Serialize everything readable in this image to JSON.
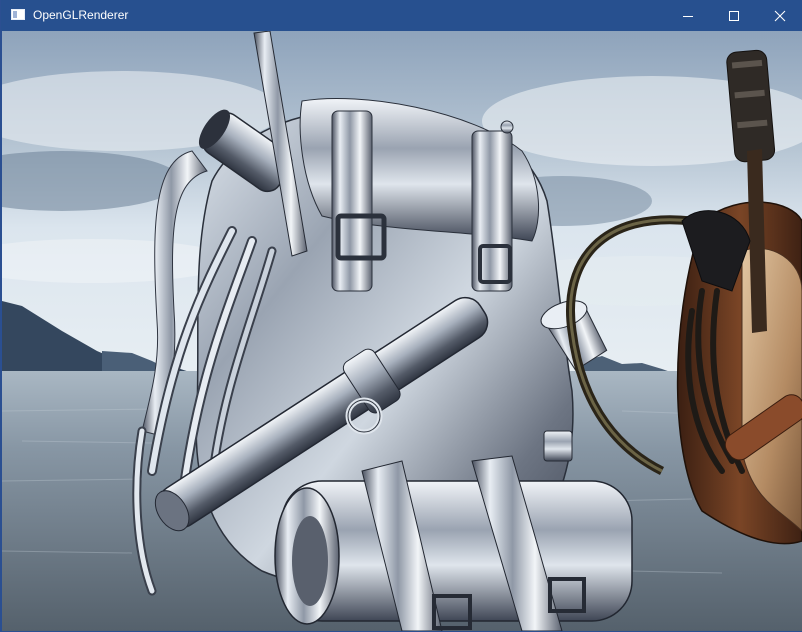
{
  "window": {
    "title": "OpenGLRenderer",
    "icon": "app-window-icon",
    "controls": [
      {
        "name": "minimize",
        "icon": "minimize-icon"
      },
      {
        "name": "maximize",
        "icon": "maximize-icon"
      },
      {
        "name": "close",
        "icon": "close-icon"
      }
    ]
  },
  "scene": {
    "description_colors": {
      "titlebar": "#27508f",
      "sky_top": "#8fa5bd",
      "sky_horizon": "#dce6ee",
      "water": "#7d8e9b",
      "mountains": "#3a4f68",
      "chrome_light": "#e9eef4",
      "chrome_dark": "#3b4250",
      "leather": "#6a3a1e",
      "canvas": "#c9a47c"
    }
  }
}
